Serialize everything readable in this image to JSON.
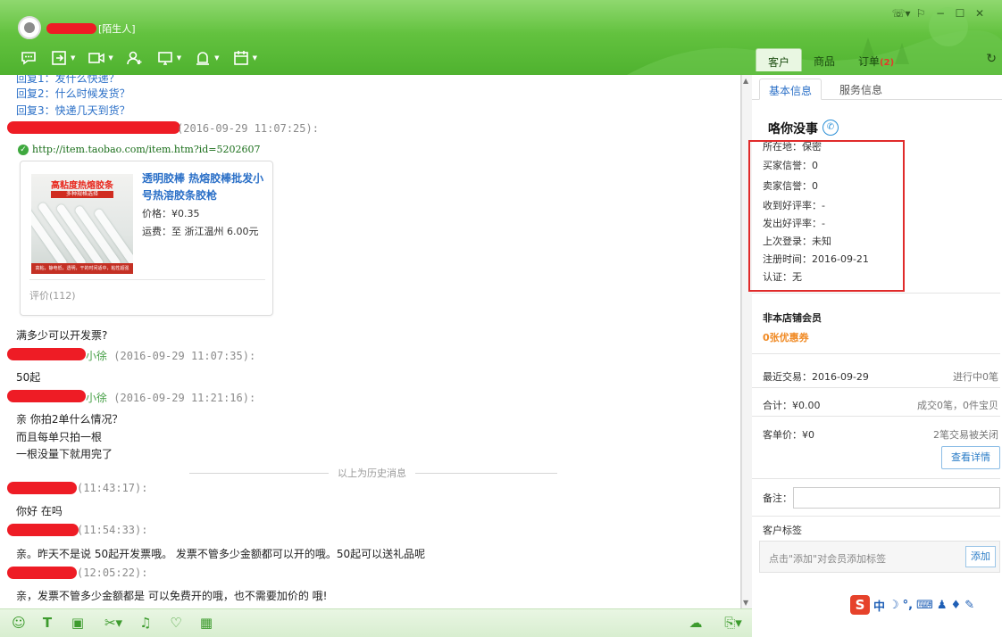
{
  "header": {
    "contact_tag": "[陌生人]",
    "tabs": [
      {
        "label": "客户",
        "active": true
      },
      {
        "label": "商品",
        "active": false
      },
      {
        "label": "订单",
        "badge": "(2)",
        "active": false
      }
    ],
    "toolbar_icons": [
      "chat-icon",
      "transfer-icon",
      "video-icon",
      "add-contact-icon",
      "screen-share-icon",
      "alarm-icon",
      "calendar-icon"
    ],
    "window_controls": [
      "phone-icon",
      "pin-icon",
      "minimize-icon",
      "maximize-icon",
      "close-icon"
    ]
  },
  "chat": {
    "quick_replies": [
      "回复1：发什么快递？",
      "回复2：什么时候发货？",
      "回复3：快递几天到货？"
    ],
    "messages": [
      {
        "time": "(2016-09-29 11:07:25):",
        "url": "http://item.taobao.com/item.htm?id=5202607"
      },
      {
        "text": "满多少可以开发票?"
      },
      {
        "name": "小徐",
        "time": "(2016-09-29 11:07:35):",
        "text": "50起"
      },
      {
        "name": "小徐",
        "time": "(2016-09-29 11:21:16):",
        "lines": [
          "亲 你拍2单什么情况？",
          "而且每单只拍一根",
          "一根没量下就用完了"
        ]
      },
      {
        "time": "(11:43:17):",
        "text": "你好 在吗"
      },
      {
        "time": "(11:54:33):",
        "text": "亲。昨天不是说 50起开发票哦。 发票不管多少金额都可以开的哦。50起可以送礼品呢"
      },
      {
        "time": "(12:05:22):",
        "text": "亲，发票不管多少金额都是 可以免费开的哦，也不需要加价的 哦!"
      }
    ],
    "history_divider": "以上为历史消息",
    "product": {
      "title": "透明胶棒 热熔胶棒批发小号热溶胶条胶枪",
      "price_label": "价格：",
      "price": "¥0.35",
      "shipping_label": "运费：",
      "shipping": "至 浙江温州 6.00元",
      "reviews": "评价(112)",
      "thumb_title": "高粘度热熔胶条",
      "thumb_tag": "多种规格选择",
      "thumb_footer": "高粘，静电低，透明，干的时间适中，粘性超强"
    }
  },
  "panel": {
    "tabs": [
      {
        "label": "基本信息",
        "active": true
      },
      {
        "label": "服务信息",
        "active": false
      }
    ],
    "customer_name": "咯你没事",
    "info": [
      {
        "label": "所在地：",
        "value": "保密"
      },
      {
        "label": "买家信誉：",
        "value": "0"
      },
      {
        "label": "卖家信誉：",
        "value": "0"
      },
      {
        "label": "收到好评率：",
        "value": "-"
      },
      {
        "label": "发出好评率：",
        "value": "-"
      },
      {
        "label": "上次登录：",
        "value": "未知"
      },
      {
        "label": "注册时间：",
        "value": "2016-09-21"
      },
      {
        "label": "认证：",
        "value": "无"
      }
    ],
    "member_status": "非本店铺会员",
    "coupons": "0张优惠券",
    "stats": {
      "recent_label": "最近交易：",
      "recent_value": "2016-09-29",
      "in_progress": "进行中0笔",
      "total_label": "合计：",
      "total_value": "¥0.00",
      "completed": "成交0笔，0件宝贝",
      "avg_label": "客单价：",
      "avg_value": "¥0",
      "closed": "2笔交易被关闭"
    },
    "details_button": "查看详情",
    "note_label": "备注：",
    "tags_label": "客户标签",
    "tags_hint": "点击\"添加\"对会员添加标签",
    "add_button": "添加",
    "ime_label": "中"
  },
  "colors": {
    "header_green": "#5bbd3a",
    "link_blue": "#2a6fc7",
    "highlight_red": "#e02b2b",
    "coupon_orange": "#f08a24"
  }
}
